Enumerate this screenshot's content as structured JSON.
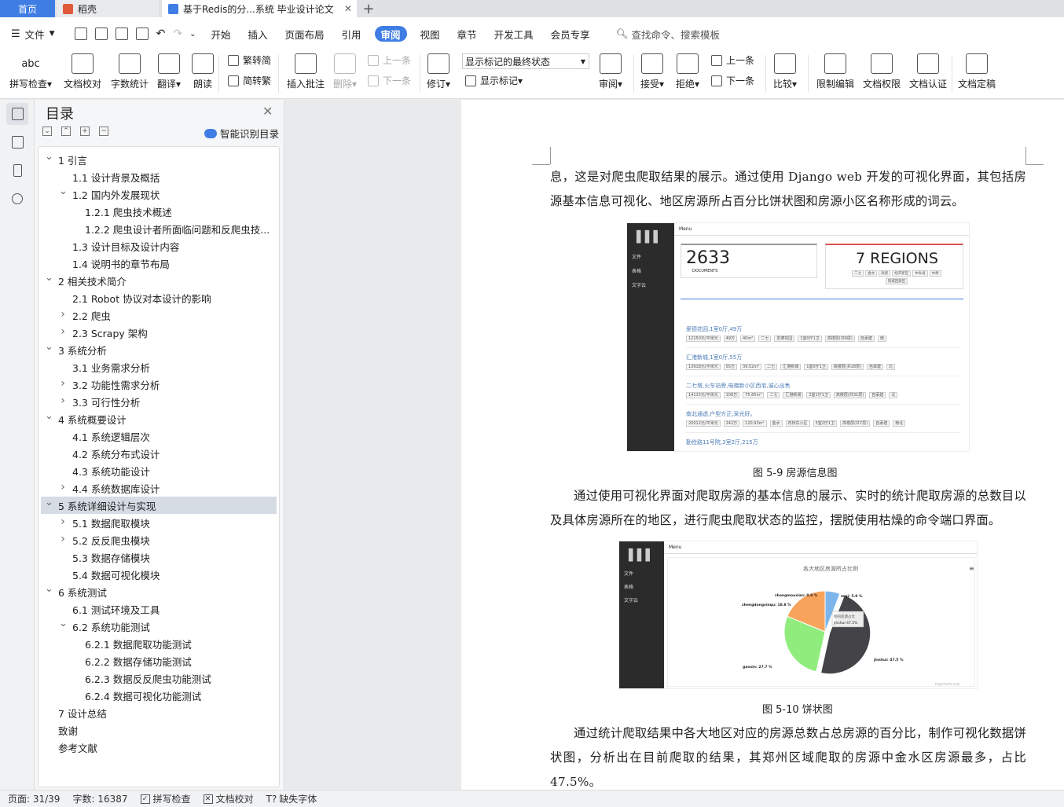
{
  "tabs": {
    "home": "首页",
    "daoke": "稻壳",
    "active_doc": "基于Redis的分...系统 毕业设计论文",
    "add": "+"
  },
  "menu": {
    "file": "文件",
    "items": [
      "开始",
      "插入",
      "页面布局",
      "引用",
      "审阅",
      "视图",
      "章节",
      "开发工具",
      "会员专享"
    ],
    "active": "审阅",
    "search_placeholder": "查找命令、搜索模板"
  },
  "ribbon": {
    "spell_check": "拼写检查",
    "doc_proof": "文档校对",
    "word_count": "字数统计",
    "translate": "翻译",
    "read_aloud": "朗读",
    "to_traditional": "繁转简",
    "to_simplified": "简转繁",
    "insert_comment": "插入批注",
    "delete": "删除",
    "prev_comment": "上一条",
    "next_comment": "下一条",
    "revise": "修订",
    "markup_select": "显示标记的最终状态",
    "show_markup": "显示标记",
    "review": "审阅",
    "accept": "接受",
    "reject": "拒绝",
    "prev_change": "上一条",
    "next_change": "下一条",
    "compare": "比较",
    "restrict_edit": "限制编辑",
    "doc_permission": "文档权限",
    "doc_cert": "文档认证",
    "doc_final": "文档定稿",
    "abc": "abc"
  },
  "toc": {
    "title": "目录",
    "smart": "智能识别目录",
    "items": [
      {
        "text": "1  引言",
        "level": 1,
        "arrow": "v"
      },
      {
        "text": "1.1  设计背景及概括",
        "level": 2,
        "arrow": ""
      },
      {
        "text": "1.2  国内外发展现状",
        "level": 2,
        "arrow": "v"
      },
      {
        "text": "1.2.1  爬虫技术概述",
        "level": 3,
        "arrow": ""
      },
      {
        "text": "1.2.2  爬虫设计者所面临问题和反爬虫技...",
        "level": 3,
        "arrow": ""
      },
      {
        "text": "1.3  设计目标及设计内容",
        "level": 2,
        "arrow": ""
      },
      {
        "text": "1.4  说明书的章节布局",
        "level": 2,
        "arrow": ""
      },
      {
        "text": "2  相关技术简介",
        "level": 1,
        "arrow": "v"
      },
      {
        "text": "2.1 Robot 协议对本设计的影响",
        "level": 2,
        "arrow": ""
      },
      {
        "text": "2.2  爬虫",
        "level": 2,
        "arrow": ">"
      },
      {
        "text": "2.3 Scrapy 架构",
        "level": 2,
        "arrow": ">"
      },
      {
        "text": "3  系统分析",
        "level": 1,
        "arrow": "v"
      },
      {
        "text": "3.1  业务需求分析",
        "level": 2,
        "arrow": ""
      },
      {
        "text": "3.2  功能性需求分析",
        "level": 2,
        "arrow": ">"
      },
      {
        "text": "3.3  可行性分析",
        "level": 2,
        "arrow": ">"
      },
      {
        "text": "4  系统概要设计",
        "level": 1,
        "arrow": "v"
      },
      {
        "text": "4.1  系统逻辑层次",
        "level": 2,
        "arrow": ""
      },
      {
        "text": "4.2  系统分布式设计",
        "level": 2,
        "arrow": ""
      },
      {
        "text": "4.3  系统功能设计",
        "level": 2,
        "arrow": ""
      },
      {
        "text": "4.4  系统数据库设计",
        "level": 2,
        "arrow": ">"
      },
      {
        "text": "5  系统详细设计与实现",
        "level": 1,
        "arrow": "v",
        "selected": true
      },
      {
        "text": "5.1  数据爬取模块",
        "level": 2,
        "arrow": ">"
      },
      {
        "text": "5.2  反反爬虫模块",
        "level": 2,
        "arrow": ">"
      },
      {
        "text": "5.3  数据存储模块",
        "level": 2,
        "arrow": ""
      },
      {
        "text": "5.4  数据可视化模块",
        "level": 2,
        "arrow": ""
      },
      {
        "text": "6  系统测试",
        "level": 1,
        "arrow": "v"
      },
      {
        "text": "6.1  测试环境及工具",
        "level": 2,
        "arrow": ""
      },
      {
        "text": "6.2  系统功能测试",
        "level": 2,
        "arrow": "v"
      },
      {
        "text": "6.2.1  数据爬取功能测试",
        "level": 3,
        "arrow": ""
      },
      {
        "text": "6.2.2  数据存储功能测试",
        "level": 3,
        "arrow": ""
      },
      {
        "text": "6.2.3  数据反反爬虫功能测试",
        "level": 3,
        "arrow": ""
      },
      {
        "text": "6.2.4  数据可视化功能测试",
        "level": 3,
        "arrow": ""
      },
      {
        "text": "7  设计总结",
        "level": 1,
        "arrow": ""
      },
      {
        "text": "致谢",
        "level": 1,
        "arrow": ""
      },
      {
        "text": "参考文献",
        "level": 1,
        "arrow": ""
      }
    ]
  },
  "doc": {
    "para1": "息，这是对爬虫爬取结果的展示。通过使用 Django web 开发的可视化界面，其包括房源基本信息可视化、地区房源所占百分比饼状图和房源小区名称形成的词云。",
    "caption1": "图 5-9  房源信息图",
    "para2": "通过使用可视化界面对爬取房源的基本信息的展示、实时的统计爬取房源的总数目以及具体房源所在的地区，进行爬虫爬取状态的监控，摆脱使用枯燥的命令端口界面。",
    "caption2": "图 5-10  饼状图",
    "para3": "通过统计爬取结果中各大地区对应的房源总数占总房源的百分比，制作可视化数据饼状图，分析出在目前爬取的结果，其郑州区域爬取的房源中金水区房源最多，占比 47.5%。"
  },
  "screenshot1": {
    "menu": "Menu",
    "nav": [
      "文件",
      "表格",
      "文字云"
    ],
    "documents_count": "2633",
    "documents_label": "DOCUMENTS",
    "regions": "7 REGIONS",
    "region_tags": [
      "二七",
      "金水",
      "高新",
      "经开新区",
      "中牟县",
      "中原",
      "管城回族区"
    ],
    "listings": [
      {
        "title": "爱德花园,1室0厅,49万",
        "tags": [
          "12250元/平米元",
          "49万",
          "40m²",
          "二七",
          "爱德花园",
          "1室0厅1卫",
          "高楼层(共6层)",
          "自承建",
          "南"
        ]
      },
      {
        "title": "汇港新城,1室0厅,55万",
        "tags": [
          "13918元/平米元",
          "55万",
          "39.52m²",
          "二七",
          "汇港新城",
          "1室0厅1卫",
          "高楼层(共28层)",
          "自承建",
          "北"
        ]
      },
      {
        "title": "二七塔,火车站旁,电梯新小区西宅,诚心出售",
        "tags": [
          "14115元/平米元",
          "106万",
          "75.65m²",
          "二七",
          "汇港新城",
          "2室1厅1卫",
          "高楼层(共31层)",
          "自承建",
          "北"
        ]
      },
      {
        "title": "南北通透,户型方正,采光好。",
        "tags": [
          "20012元/平米元",
          "242万",
          "120.93m²",
          "金水",
          "石桥东小区",
          "3室2厅1卫",
          "高楼层(共7层)",
          "自承建",
          "南北"
        ]
      },
      {
        "title": "勤俭路11号院,3室2厅,215万",
        "tags": []
      }
    ]
  },
  "screenshot2": {
    "menu": "Menu",
    "nav": [
      "文件",
      "表格",
      "文字云"
    ],
    "chart_title": "各大地区房源所占比例",
    "tooltip_title": "郑州房源占比",
    "tooltip_value": "jinshui  47.5%",
    "credits": "Highcharts.com",
    "chart_data": {
      "type": "pie",
      "title": "各大地区房源所占比例",
      "labels": [
        "jinshui",
        "gaoxin",
        "zhengdongxinqu",
        "zhongmouxian",
        "erqi"
      ],
      "values": [
        47.5,
        27.7,
        18.8,
        0.0,
        5.9
      ],
      "display_labels": [
        "jinshui: 47.5 %",
        "gaoxin: 27.7 %",
        "zhengdongxinqu: 18.8 %",
        "zhongmouxian: 0.0 %",
        "erqi: 5.9 %"
      ],
      "colors": [
        "#434348",
        "#90ed7d",
        "#f7a35c",
        "#8085e9",
        "#7cb5ec"
      ]
    }
  },
  "status": {
    "page": "页面: 31/39",
    "words": "字数: 16387",
    "spell": "拼写检查",
    "proof": "文档校对",
    "missing_font": "缺失字体"
  }
}
